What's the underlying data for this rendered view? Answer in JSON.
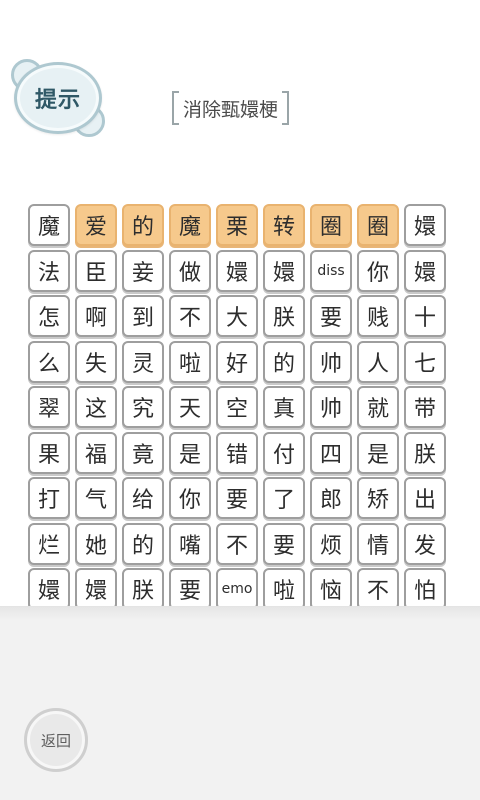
{
  "hint_button": {
    "label": "提示"
  },
  "title": "消除甄嬛梗",
  "grid": {
    "rows": [
      [
        {
          "text": "魔",
          "selected": false
        },
        {
          "text": "爱",
          "selected": true
        },
        {
          "text": "的",
          "selected": true
        },
        {
          "text": "魔",
          "selected": true
        },
        {
          "text": "栗",
          "selected": true
        },
        {
          "text": "转",
          "selected": true
        },
        {
          "text": "圈",
          "selected": true
        },
        {
          "text": "圈",
          "selected": true
        },
        {
          "text": "嬛",
          "selected": false
        }
      ],
      [
        {
          "text": "法",
          "selected": false
        },
        {
          "text": "臣",
          "selected": false
        },
        {
          "text": "妾",
          "selected": false
        },
        {
          "text": "做",
          "selected": false
        },
        {
          "text": "嬛",
          "selected": false
        },
        {
          "text": "嬛",
          "selected": false
        },
        {
          "text": "diss",
          "selected": false
        },
        {
          "text": "你",
          "selected": false
        },
        {
          "text": "嬛",
          "selected": false
        }
      ],
      [
        {
          "text": "怎",
          "selected": false
        },
        {
          "text": "啊",
          "selected": false
        },
        {
          "text": "到",
          "selected": false
        },
        {
          "text": "不",
          "selected": false
        },
        {
          "text": "大",
          "selected": false
        },
        {
          "text": "朕",
          "selected": false
        },
        {
          "text": "要",
          "selected": false
        },
        {
          "text": "贱",
          "selected": false
        },
        {
          "text": "十",
          "selected": false
        }
      ],
      [
        {
          "text": "么",
          "selected": false
        },
        {
          "text": "失",
          "selected": false
        },
        {
          "text": "灵",
          "selected": false
        },
        {
          "text": "啦",
          "selected": false
        },
        {
          "text": "好",
          "selected": false
        },
        {
          "text": "的",
          "selected": false
        },
        {
          "text": "帅",
          "selected": false
        },
        {
          "text": "人",
          "selected": false
        },
        {
          "text": "七",
          "selected": false
        }
      ],
      [
        {
          "text": "翠",
          "selected": false
        },
        {
          "text": "这",
          "selected": false
        },
        {
          "text": "究",
          "selected": false
        },
        {
          "text": "天",
          "selected": false
        },
        {
          "text": "空",
          "selected": false
        },
        {
          "text": "真",
          "selected": false
        },
        {
          "text": "帅",
          "selected": false
        },
        {
          "text": "就",
          "selected": false
        },
        {
          "text": "带",
          "selected": false
        }
      ],
      [
        {
          "text": "果",
          "selected": false
        },
        {
          "text": "福",
          "selected": false
        },
        {
          "text": "竟",
          "selected": false
        },
        {
          "text": "是",
          "selected": false
        },
        {
          "text": "错",
          "selected": false
        },
        {
          "text": "付",
          "selected": false
        },
        {
          "text": "四",
          "selected": false
        },
        {
          "text": "是",
          "selected": false
        },
        {
          "text": "朕",
          "selected": false
        }
      ],
      [
        {
          "text": "打",
          "selected": false
        },
        {
          "text": "气",
          "selected": false
        },
        {
          "text": "给",
          "selected": false
        },
        {
          "text": "你",
          "selected": false
        },
        {
          "text": "要",
          "selected": false
        },
        {
          "text": "了",
          "selected": false
        },
        {
          "text": "郎",
          "selected": false
        },
        {
          "text": "矫",
          "selected": false
        },
        {
          "text": "出",
          "selected": false
        }
      ],
      [
        {
          "text": "烂",
          "selected": false
        },
        {
          "text": "她",
          "selected": false
        },
        {
          "text": "的",
          "selected": false
        },
        {
          "text": "嘴",
          "selected": false
        },
        {
          "text": "不",
          "selected": false
        },
        {
          "text": "要",
          "selected": false
        },
        {
          "text": "烦",
          "selected": false
        },
        {
          "text": "情",
          "selected": false
        },
        {
          "text": "发",
          "selected": false
        }
      ],
      [
        {
          "text": "嬛",
          "selected": false
        },
        {
          "text": "嬛",
          "selected": false
        },
        {
          "text": "朕",
          "selected": false
        },
        {
          "text": "要",
          "selected": false
        },
        {
          "text": "emo",
          "selected": false
        },
        {
          "text": "啦",
          "selected": false
        },
        {
          "text": "恼",
          "selected": false
        },
        {
          "text": "不",
          "selected": false
        },
        {
          "text": "怕",
          "selected": false
        }
      ]
    ]
  },
  "back_button": {
    "label": "返回"
  },
  "colors": {
    "selected_tile": "#f6c98c",
    "tile_border": "#9e9e9e",
    "hint_button_fill": "#e7f1f4",
    "hint_text": "#2f5866"
  }
}
